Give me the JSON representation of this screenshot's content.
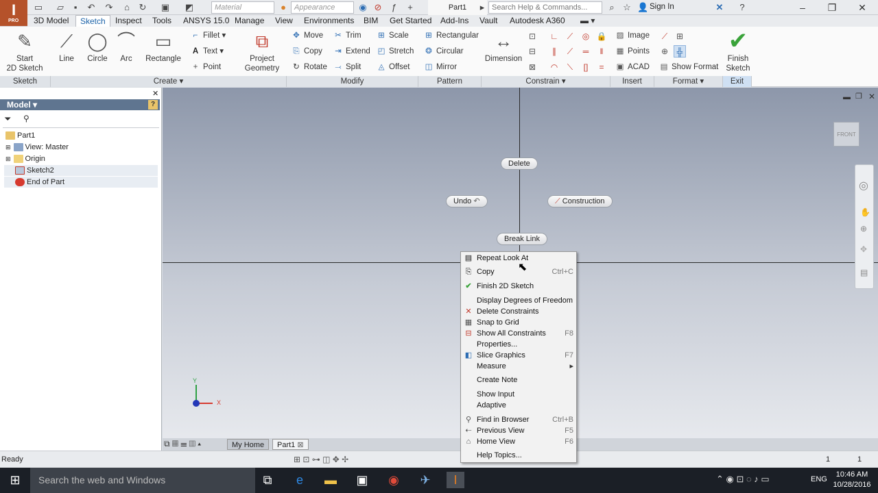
{
  "app": {
    "logo": "I",
    "edition": "PRO",
    "document_title": "Part1"
  },
  "qat": {
    "material_placeholder": "Material",
    "appearance_placeholder": "Appearance",
    "help_search_placeholder": "Search Help & Commands...",
    "sign_in": "Sign In"
  },
  "tabs": [
    "3D Model",
    "Sketch",
    "Inspect",
    "Tools",
    "ANSYS 15.0",
    "Manage",
    "View",
    "Environments",
    "BIM",
    "Get Started",
    "Add-Ins",
    "Vault",
    "Autodesk A360"
  ],
  "ribbon": {
    "start_sketch": "Start\n2D Sketch",
    "line": "Line",
    "circle": "Circle",
    "arc": "Arc",
    "rectangle": "Rectangle",
    "fillet": "Fillet",
    "text": "Text",
    "point": "Point",
    "project_geometry": "Project\nGeometry",
    "move": "Move",
    "copy": "Copy",
    "rotate": "Rotate",
    "trim": "Trim",
    "extend": "Extend",
    "split": "Split",
    "scale": "Scale",
    "stretch": "Stretch",
    "offset": "Offset",
    "pat_rectangular": "Rectangular",
    "pat_circular": "Circular",
    "pat_mirror": "Mirror",
    "dimension": "Dimension",
    "image": "Image",
    "points": "Points",
    "acad": "ACAD",
    "show_format": "Show Format",
    "finish_sketch": "Finish\nSketch",
    "groups": {
      "sketch": "Sketch",
      "create": "Create",
      "modify": "Modify",
      "pattern": "Pattern",
      "constrain": "Constrain",
      "insert": "Insert",
      "format": "Format",
      "exit": "Exit"
    }
  },
  "browser": {
    "title": "Model",
    "items": [
      "Part1",
      "View: Master",
      "Origin",
      "Sketch2",
      "End of Part"
    ]
  },
  "viewport": {
    "marking_menu": {
      "delete": "Delete",
      "undo": "Undo",
      "construction": "Construction",
      "break_link": "Break Link"
    },
    "viewcube": "FRONT",
    "axis_x": "X",
    "axis_y": "Y"
  },
  "context_menu": [
    {
      "label": "Repeat Look At",
      "shortcut": "",
      "icon": "look-at-icon"
    },
    {
      "label": "Copy",
      "shortcut": "Ctrl+C",
      "icon": "copy-icon"
    },
    {
      "label": "Finish 2D Sketch",
      "shortcut": "",
      "icon": "checkmark-icon"
    },
    {
      "label": "Display Degrees of Freedom",
      "shortcut": "",
      "icon": ""
    },
    {
      "label": "Delete Constraints",
      "shortcut": "",
      "icon": "delete-constraints-icon"
    },
    {
      "label": "Snap to Grid",
      "shortcut": "",
      "icon": "grid-icon"
    },
    {
      "label": "Show All Constraints",
      "shortcut": "F8",
      "icon": "constraints-icon"
    },
    {
      "label": "Properties...",
      "shortcut": "",
      "icon": ""
    },
    {
      "label": "Slice Graphics",
      "shortcut": "F7",
      "icon": "slice-icon"
    },
    {
      "label": "Measure",
      "shortcut": "",
      "icon": "",
      "submenu": true
    },
    {
      "label": "Create Note",
      "shortcut": "",
      "icon": ""
    },
    {
      "label": "Show Input",
      "shortcut": "",
      "icon": ""
    },
    {
      "label": "Adaptive",
      "shortcut": "",
      "icon": ""
    },
    {
      "label": "Find in Browser",
      "shortcut": "Ctrl+B",
      "icon": "find-icon"
    },
    {
      "label": "Previous View",
      "shortcut": "F5",
      "icon": "previous-view-icon"
    },
    {
      "label": "Home View",
      "shortcut": "F6",
      "icon": "home-icon"
    },
    {
      "label": "Help Topics...",
      "shortcut": "",
      "icon": ""
    }
  ],
  "doc_tabs": {
    "home": "My Home",
    "part": "Part1"
  },
  "status": {
    "text": "Ready",
    "right1": "1",
    "right2": "1"
  },
  "taskbar": {
    "search": "Search the web and Windows",
    "lang": "ENG",
    "time": "10:46 AM",
    "date": "10/28/2016"
  },
  "colors": {
    "accent": "#1b62a8",
    "app": "#b5522a",
    "finish": "#3aa33a"
  }
}
